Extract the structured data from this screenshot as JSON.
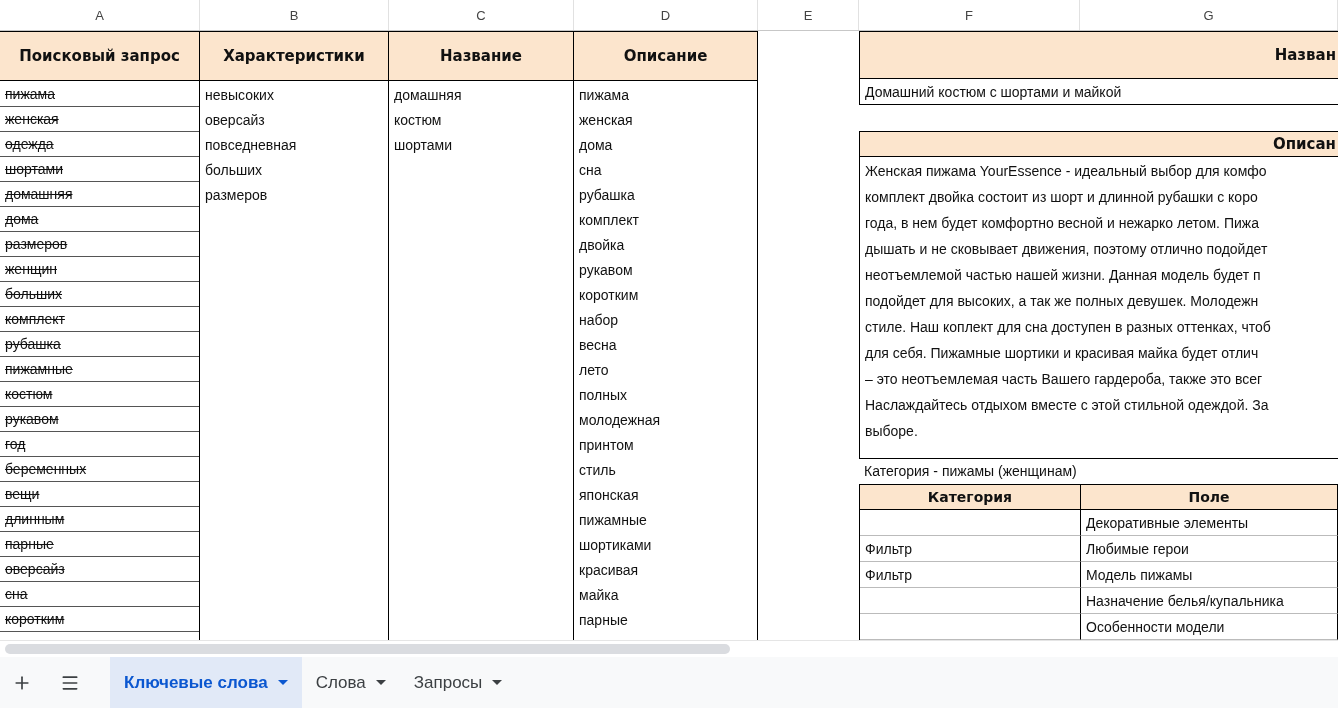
{
  "column_letters": [
    "A",
    "B",
    "C",
    "D",
    "E",
    "F",
    "G"
  ],
  "search_queries": {
    "heading": "Поисковый запрос",
    "items": [
      {
        "text": "пижама",
        "struck": true
      },
      {
        "text": "женская",
        "struck": true
      },
      {
        "text": "одежда",
        "struck": true
      },
      {
        "text": "шортами",
        "struck": true
      },
      {
        "text": "домашняя",
        "struck": true
      },
      {
        "text": "дома",
        "struck": true
      },
      {
        "text": "размеров",
        "struck": true
      },
      {
        "text": "женщин",
        "struck": true
      },
      {
        "text": "больших",
        "struck": true
      },
      {
        "text": "комплект",
        "struck": true
      },
      {
        "text": "рубашка",
        "struck": true
      },
      {
        "text": "пижамные",
        "struck": true
      },
      {
        "text": "костюм",
        "struck": true
      },
      {
        "text": "рукавом",
        "struck": true
      },
      {
        "text": "год",
        "struck": true
      },
      {
        "text": "беременных",
        "struck": true
      },
      {
        "text": "вещи",
        "struck": true
      },
      {
        "text": "длинным",
        "struck": true
      },
      {
        "text": "парные",
        "struck": true
      },
      {
        "text": "оверсайз",
        "struck": true
      },
      {
        "text": "сна",
        "struck": true
      },
      {
        "text": "коротким",
        "struck": true
      }
    ]
  },
  "word_columns": [
    {
      "heading": "Характеристики",
      "items": [
        "невысоких",
        "оверсайз",
        "повседневная",
        "больших",
        "размеров"
      ]
    },
    {
      "heading": "Название",
      "items": [
        "домашняя",
        "костюм",
        "шортами"
      ]
    },
    {
      "heading": "Описание",
      "items": [
        "пижама",
        "женская",
        "дома",
        "сна",
        "рубашка",
        "комплект",
        "двойка",
        "рукавом",
        "коротким",
        "набор",
        "весна",
        "лето",
        "полных",
        "молодежная",
        "принтом",
        "стиль",
        "японская",
        "пижамные",
        "шортиками",
        "красивая",
        "майка",
        "парные"
      ]
    }
  ],
  "product_card": {
    "title_header": "Назван",
    "title": "Домашний костюм с шортами и майкой",
    "description_header": "Описан",
    "description_lines": [
      "Женская пижама YourEssence - идеальный выбор для комфо",
      "комплект двойка состоит из шорт и длинной рубашки с коро",
      "года, в нем будет комфортно весной и нежарко летом. Пижа",
      "дышать и не сковывает движения, поэтому отлично подойдет",
      "неотъемлемой частью нашей жизни. Данная модель будет п",
      "подойдет для высоких, а так же полных девушек. Молодежн",
      "стиле. Наш коплект для сна доступен в разных оттенках, чтоб",
      "для себя. Пижамные шортики и красивая майка будет отлич",
      "– это неотъемлемая часть Вашего гардероба, также это всег",
      "Наслаждайтесь отдыхом вместе с этой стильной одеждой. За",
      "выборе."
    ],
    "category_caption": "Категория - пижамы (женщинам)",
    "attributes": {
      "columns": [
        "Категория",
        "Поле"
      ],
      "rows": [
        {
          "field": "Декоративные элементы"
        },
        {
          "category": "Фильтр",
          "field": "Любимые герои"
        },
        {
          "category": "Фильтр",
          "field": "Модель пижамы"
        },
        {
          "field": "Назначение белья/купальника"
        },
        {
          "field": "Особенности модели"
        }
      ]
    }
  },
  "sheet_tabs": [
    {
      "label": "Ключевые слова",
      "selected": true
    },
    {
      "label": "Слова",
      "selected": false
    },
    {
      "label": "Запросы",
      "selected": false
    }
  ]
}
